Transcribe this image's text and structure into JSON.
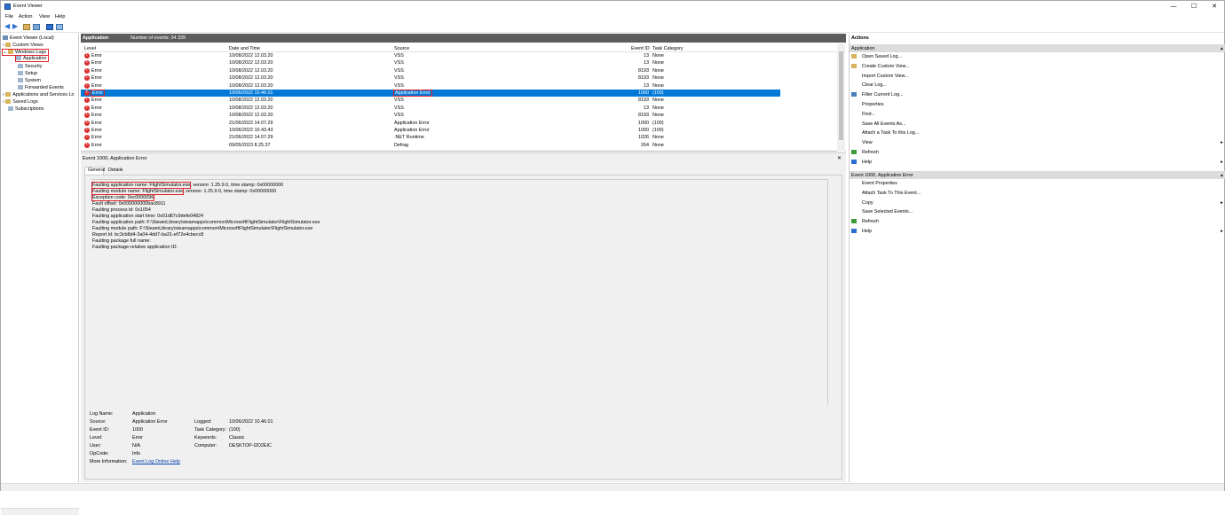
{
  "window": {
    "title": "Event Viewer",
    "minimize": "—",
    "maximize": "☐",
    "close": "✕"
  },
  "menu": [
    "File",
    "Action",
    "View",
    "Help"
  ],
  "tree": {
    "root": "Event Viewer (Local)",
    "custom_views": "Custom Views",
    "windows_logs": "Windows Logs",
    "children": [
      "Application",
      "Security",
      "Setup",
      "System",
      "Forwarded Events"
    ],
    "apps_services": "Applications and Services Lo",
    "saved_logs": "Saved Logs",
    "subscriptions": "Subscriptions"
  },
  "log_header": {
    "name": "Application",
    "count": "Number of events: 34 339"
  },
  "grid": {
    "columns": [
      "Level",
      "Date and Time",
      "Source",
      "Event ID",
      "Task Category"
    ],
    "rows": [
      {
        "level": "Error",
        "date": "10/08/2022 12.03.20",
        "source": "VSS",
        "id": "13",
        "task": "None"
      },
      {
        "level": "Error",
        "date": "10/08/2022 12.03.20",
        "source": "VSS",
        "id": "13",
        "task": "None"
      },
      {
        "level": "Error",
        "date": "10/08/2022 12.03.20",
        "source": "VSS",
        "id": "8193",
        "task": "None"
      },
      {
        "level": "Error",
        "date": "10/08/2022 12.03.20",
        "source": "VSS",
        "id": "8193",
        "task": "None"
      },
      {
        "level": "Error",
        "date": "10/08/2022 12.03.20",
        "source": "VSS",
        "id": "13",
        "task": "None"
      },
      {
        "level": "Error",
        "date": "10/06/2022 10.46.01",
        "source": "Application Error",
        "id": "1000",
        "task": "(100)"
      },
      {
        "level": "Error",
        "date": "10/08/2022 12.03.20",
        "source": "VSS",
        "id": "8193",
        "task": "None"
      },
      {
        "level": "Error",
        "date": "10/08/2022 12.03.20",
        "source": "VSS",
        "id": "13",
        "task": "None"
      },
      {
        "level": "Error",
        "date": "10/08/2022 12.03.20",
        "source": "VSS",
        "id": "8193",
        "task": "None"
      },
      {
        "level": "Error",
        "date": "21/06/2022 14.07.29",
        "source": "Application Error",
        "id": "1000",
        "task": "(100)"
      },
      {
        "level": "Error",
        "date": "10/06/2022 10.43.43",
        "source": "Application Error",
        "id": "1000",
        "task": "(100)"
      },
      {
        "level": "Error",
        "date": "21/06/2022 14.07.29",
        "source": ".NET Runtime",
        "id": "1026",
        "task": "None"
      },
      {
        "level": "Error",
        "date": "09/05/2023 8.25.37",
        "source": "Defrag",
        "id": "264",
        "task": "None"
      }
    ]
  },
  "detail": {
    "title": "Event 1000, Application Error",
    "close": "✕",
    "tabs": [
      "General",
      "Details"
    ],
    "lines": [
      "Faulting application name: FlightSimulator.exe, version: 1.25.9.0, time stamp: 0x00000000",
      "Faulting module name: FlightSimulator.exe, version: 1.25.9.0, time stamp: 0x00000000",
      "Exception code: 0xc0000096",
      "Fault offset: 0x000000000bac8911",
      "Faulting process id: 0x1054",
      "Faulting application start time: 0x01d87c9defe04824",
      "Faulting application path: F:\\SteamLibrary\\steamapps\\common\\MicrosoftFlightSimulator\\FlightSimulator.exe",
      "Faulting module path: F:\\SteamLibrary\\steamapps\\common\\MicrosoftFlightSimulator\\FlightSimulator.exe",
      "Report Id: bc3cb8d4-3a04-4dd7-ba31-ef72e4cbecc8",
      "Faulting package full name:",
      "Faulting package-relative application ID:"
    ],
    "props": {
      "log_name_l": "Log Name:",
      "log_name": "Application",
      "source_l": "Source:",
      "source": "Application Error",
      "logged_l": "Logged:",
      "logged": "10/06/2022 10.46.01",
      "event_id_l": "Event ID:",
      "event_id": "1000",
      "task_l": "Task Category:",
      "task": "(100)",
      "level_l": "Level:",
      "level": "Error",
      "keywords_l": "Keywords:",
      "keywords": "Classic",
      "user_l": "User:",
      "user": "N/A",
      "computer_l": "Computer:",
      "computer": "DESKTOP-I2D2EIC",
      "opcode_l": "OpCode:",
      "opcode": "Info",
      "more_l": "More Information:",
      "more": "Event Log Online Help"
    }
  },
  "actions": {
    "title": "Actions",
    "app_header": "Application",
    "app_items": [
      "Open Saved Log...",
      "Create Custom View...",
      "Import Custom View...",
      "Clear Log...",
      "Filter Current Log...",
      "Properties",
      "Find...",
      "Save All Events As...",
      "Attach a Task To this Log...",
      "View",
      "Refresh",
      "Help"
    ],
    "event_header": "Event 1000, Application Error",
    "event_items": [
      "Event Properties",
      "Attach Task To This Event...",
      "Copy",
      "Save Selected Events...",
      "Refresh",
      "Help"
    ],
    "chevron": "▴",
    "arrow": "▸"
  }
}
